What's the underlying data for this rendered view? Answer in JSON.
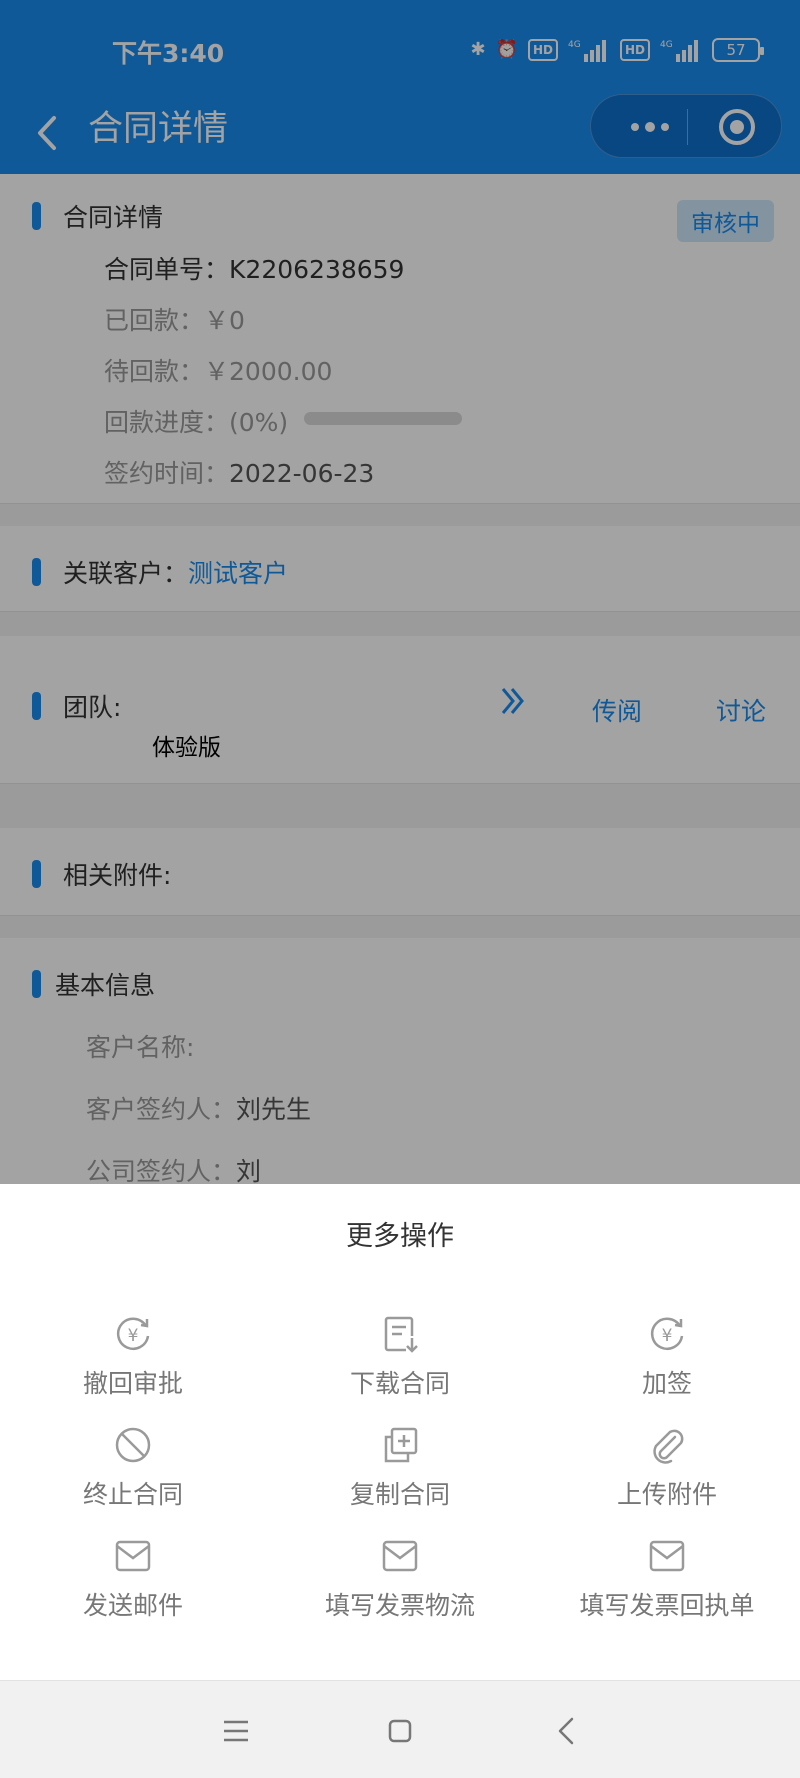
{
  "status": {
    "time": "下午3:40",
    "battery": "57",
    "hd": "HD",
    "net": "4G"
  },
  "nav": {
    "title": "合同详情"
  },
  "contract": {
    "section_title": "合同详情",
    "status_badge": "审核中",
    "number_label": "合同单号：",
    "number": "K2206238659",
    "paid_label": "已回款：",
    "paid": "￥0",
    "pending_label": "待回款：",
    "pending": "￥2000.00",
    "progress_label": "回款进度：",
    "progress_text": "(0%)",
    "progress": 0,
    "sign_date_label": "签约时间：",
    "sign_date": "2022-06-23"
  },
  "customer": {
    "label": "关联客户：",
    "name": "测试客户"
  },
  "team": {
    "label": "团队:",
    "version": "体验版",
    "circulate": "传阅",
    "discuss": "讨论"
  },
  "attachments": {
    "label": "相关附件:"
  },
  "basic": {
    "title": "基本信息",
    "customer_name_label": "客户名称:",
    "customer_signer_label": "客户签约人：",
    "customer_signer": "刘先生",
    "company_signer_label": "公司签约人：",
    "company_signer": "刘"
  },
  "sheet": {
    "title": "更多操作",
    "actions": [
      {
        "label": "撤回审批",
        "icon": "yen-refresh-icon"
      },
      {
        "label": "下载合同",
        "icon": "download-document-icon"
      },
      {
        "label": "加签",
        "icon": "yen-refresh-icon"
      },
      {
        "label": "终止合同",
        "icon": "prohibit-icon"
      },
      {
        "label": "复制合同",
        "icon": "copy-icon"
      },
      {
        "label": "上传附件",
        "icon": "paperclip-icon"
      },
      {
        "label": "发送邮件",
        "icon": "mail-icon"
      },
      {
        "label": "填写发票物流",
        "icon": "mail-icon"
      },
      {
        "label": "填写发票回执单",
        "icon": "mail-icon"
      }
    ]
  },
  "colors": {
    "primary": "#1a8cf0",
    "icon_gray": "#9a9a9a"
  }
}
